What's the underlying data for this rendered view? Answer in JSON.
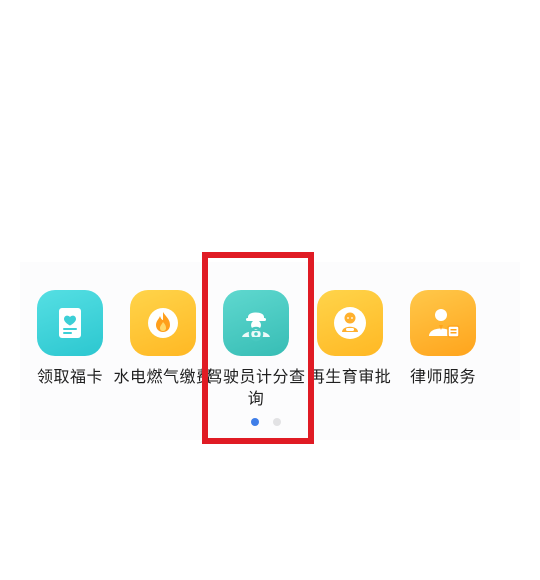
{
  "services": [
    {
      "label": "领取福卡",
      "icon": "blessing-card-icon",
      "color": "#38cfd6"
    },
    {
      "label": "水电燃气缴费",
      "icon": "flame-icon",
      "color": "#ffc336"
    },
    {
      "label": "驾驶员计分查询",
      "icon": "driver-icon",
      "color": "#48c8c0"
    },
    {
      "label": "再生育审批",
      "icon": "baby-icon",
      "color": "#ffc336"
    },
    {
      "label": "律师服务",
      "icon": "lawyer-icon",
      "color": "#ffb42e"
    }
  ],
  "highlight": {
    "color": "#e01b24",
    "target": "驾驶员计分查询"
  },
  "pager": {
    "pages": 2,
    "current": 1,
    "active_color": "#3f7ee8",
    "inactive_color": "#e2e2e4"
  }
}
